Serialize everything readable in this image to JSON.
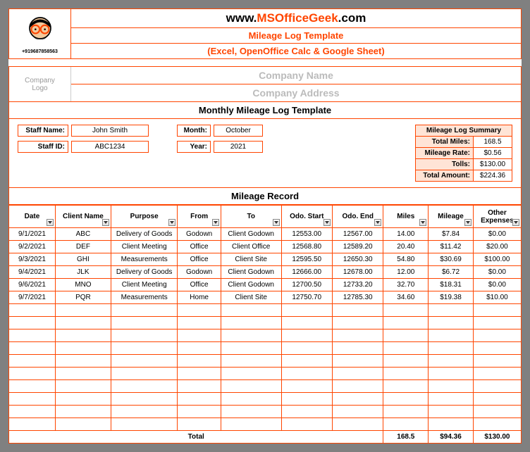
{
  "header": {
    "phone": "+919687858563",
    "url_prefix": "www.",
    "url_main": "MSOfficeGeek",
    "url_suffix": ".com",
    "sub1": "Mileage Log Template",
    "sub2": "(Excel, OpenOffice Calc & Google Sheet)"
  },
  "company": {
    "logo_label": "Company\nLogo",
    "name": "Company Name",
    "address": "Company Address"
  },
  "section_title": "Monthly Mileage Log Template",
  "info": {
    "staff_name_label": "Staff Name:",
    "staff_name": "John Smith",
    "staff_id_label": "Staff ID:",
    "staff_id": "ABC1234",
    "month_label": "Month:",
    "month": "October",
    "year_label": "Year:",
    "year": "2021"
  },
  "summary": {
    "title": "Mileage Log Summary",
    "rows": [
      {
        "label": "Total Miles:",
        "value": "168.5"
      },
      {
        "label": "Mileage Rate:",
        "value": "$0.56"
      },
      {
        "label": "Tolls:",
        "value": "$130.00"
      },
      {
        "label": "Total Amount:",
        "value": "$224.36"
      }
    ]
  },
  "record_title": "Mileage Record",
  "columns": [
    "Date",
    "Client Name",
    "Purpose",
    "From",
    "To",
    "Odo. Start",
    "Odo. End",
    "Miles",
    "Mileage",
    "Other Expenses"
  ],
  "rows": [
    {
      "date": "9/1/2021",
      "client": "ABC",
      "purpose": "Delivery of Goods",
      "from": "Godown",
      "to": "Client Godown",
      "ostart": "12553.00",
      "oend": "12567.00",
      "miles": "14.00",
      "mileage": "$7.84",
      "other": "$0.00"
    },
    {
      "date": "9/2/2021",
      "client": "DEF",
      "purpose": "Client Meeting",
      "from": "Office",
      "to": "Client Office",
      "ostart": "12568.80",
      "oend": "12589.20",
      "miles": "20.40",
      "mileage": "$11.42",
      "other": "$20.00"
    },
    {
      "date": "9/3/2021",
      "client": "GHI",
      "purpose": "Measurements",
      "from": "Office",
      "to": "Client Site",
      "ostart": "12595.50",
      "oend": "12650.30",
      "miles": "54.80",
      "mileage": "$30.69",
      "other": "$100.00"
    },
    {
      "date": "9/4/2021",
      "client": "JLK",
      "purpose": "Delivery of Goods",
      "from": "Godown",
      "to": "Client Godown",
      "ostart": "12666.00",
      "oend": "12678.00",
      "miles": "12.00",
      "mileage": "$6.72",
      "other": "$0.00"
    },
    {
      "date": "9/6/2021",
      "client": "MNO",
      "purpose": "Client Meeting",
      "from": "Office",
      "to": "Client Godown",
      "ostart": "12700.50",
      "oend": "12733.20",
      "miles": "32.70",
      "mileage": "$18.31",
      "other": "$0.00"
    },
    {
      "date": "9/7/2021",
      "client": "PQR",
      "purpose": "Measurements",
      "from": "Home",
      "to": "Client Site",
      "ostart": "12750.70",
      "oend": "12785.30",
      "miles": "34.60",
      "mileage": "$19.38",
      "other": "$10.00"
    }
  ],
  "totals": {
    "label": "Total",
    "miles": "168.5",
    "mileage": "$94.36",
    "other": "$130.00"
  }
}
